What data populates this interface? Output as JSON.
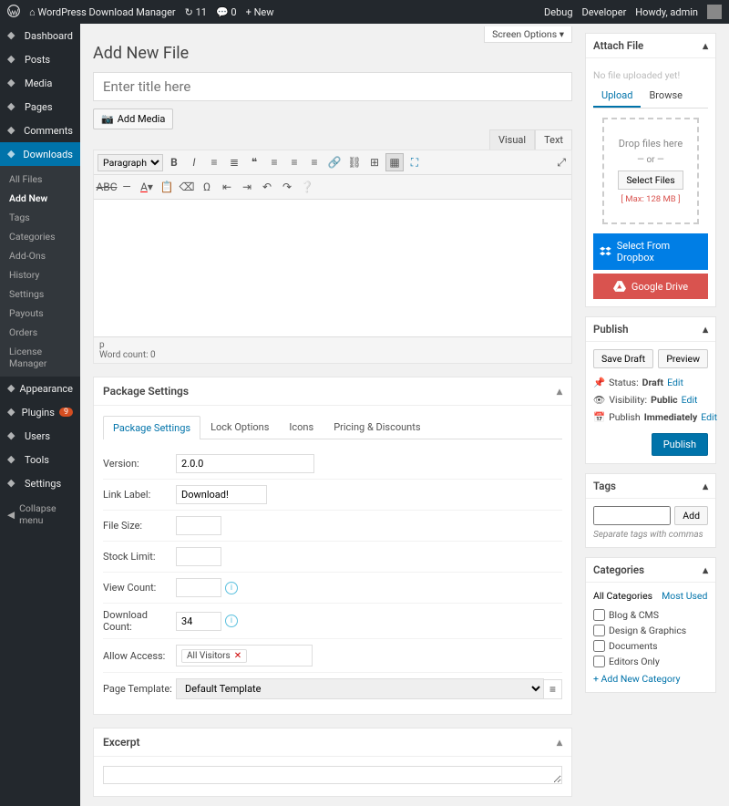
{
  "topbar": {
    "site": "WordPress Download Manager",
    "updates": "11",
    "comments": "0",
    "new": "New",
    "debug": "Debug",
    "developer": "Developer",
    "howdy": "Howdy, admin"
  },
  "screen_options": "Screen Options ▾",
  "sidebar": {
    "items": [
      {
        "label": "Dashboard",
        "icon": "dash"
      },
      {
        "label": "Posts",
        "icon": "pin"
      },
      {
        "label": "Media",
        "icon": "media"
      },
      {
        "label": "Pages",
        "icon": "page"
      },
      {
        "label": "Comments",
        "icon": "comment"
      },
      {
        "label": "Downloads",
        "icon": "download",
        "current": true
      },
      {
        "label": "Appearance",
        "icon": "brush"
      },
      {
        "label": "Plugins",
        "icon": "plug",
        "badge": "9"
      },
      {
        "label": "Users",
        "icon": "user"
      },
      {
        "label": "Tools",
        "icon": "tool"
      },
      {
        "label": "Settings",
        "icon": "gear"
      }
    ],
    "sub": [
      "All Files",
      "Add New",
      "Tags",
      "Categories",
      "Add-Ons",
      "History",
      "Settings",
      "Payouts",
      "Orders",
      "License Manager"
    ],
    "sub_current": 1,
    "collapse": "Collapse menu"
  },
  "page": {
    "title": "Add New File",
    "title_placeholder": "Enter title here",
    "add_media": "Add Media",
    "editor_tabs": {
      "visual": "Visual",
      "text": "Text"
    },
    "format_select": "Paragraph",
    "path": "p",
    "word_count": "Word count: 0"
  },
  "package": {
    "heading": "Package Settings",
    "tabs": [
      "Package Settings",
      "Lock Options",
      "Icons",
      "Pricing & Discounts"
    ],
    "version_label": "Version:",
    "version": "2.0.0",
    "link_label_label": "Link Label:",
    "link_label": "Download!",
    "file_size_label": "File Size:",
    "file_size": "",
    "stock_label": "Stock Limit:",
    "stock": "",
    "view_label": "View Count:",
    "view": "",
    "dl_label": "Download Count:",
    "dl": "34",
    "access_label": "Allow Access:",
    "access_tag": "All Visitors",
    "tmpl_label": "Page Template:",
    "tmpl": "Default Template"
  },
  "excerpt": {
    "heading": "Excerpt"
  },
  "attach": {
    "heading": "Attach File",
    "nofile": "No file uploaded yet!",
    "tab_upload": "Upload",
    "tab_browse": "Browse",
    "drop": "Drop files here",
    "or": "— or —",
    "select": "Select Files",
    "max": "[ Max: 128 MB ]",
    "dropbox": "Select From Dropbox",
    "gdrive": "Google Drive"
  },
  "publish": {
    "heading": "Publish",
    "save": "Save Draft",
    "preview": "Preview",
    "status_label": "Status:",
    "status": "Draft",
    "edit": "Edit",
    "vis_label": "Visibility:",
    "vis": "Public",
    "pub_label": "Publish",
    "pub_val": "Immediately",
    "button": "Publish"
  },
  "tags": {
    "heading": "Tags",
    "add": "Add",
    "note": "Separate tags with commas"
  },
  "categories": {
    "heading": "Categories",
    "tab_all": "All Categories",
    "tab_most": "Most Used",
    "list": [
      "Blog & CMS",
      "Design & Graphics",
      "Documents",
      "Editors Only"
    ],
    "add": "+ Add New Category"
  }
}
